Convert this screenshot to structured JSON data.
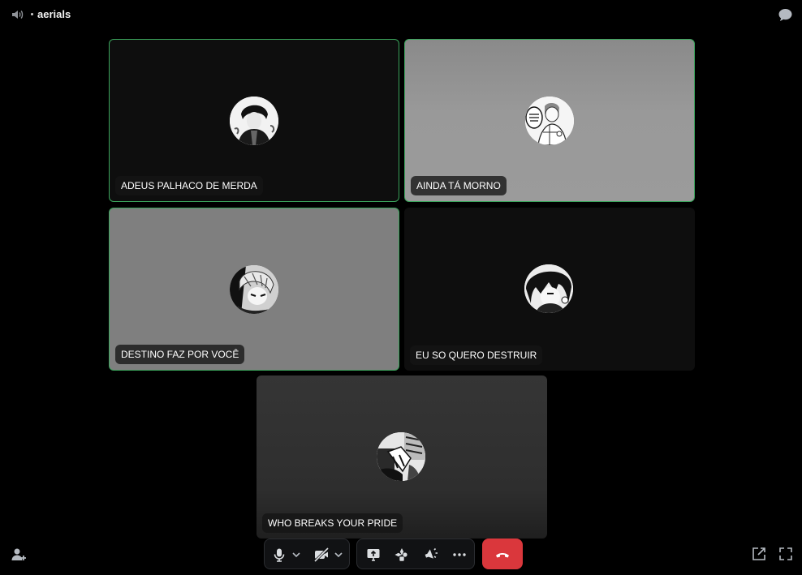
{
  "channel": {
    "name": "aerials"
  },
  "participants": [
    {
      "name": "ADEUS PALHACO DE MERDA"
    },
    {
      "name": "AINDA TÁ MORNO"
    },
    {
      "name": "DESTINO FAZ POR VOCÊ"
    },
    {
      "name": "EU SO QUERO DESTRUIR"
    },
    {
      "name": "WHO BREAKS YOUR PRIDE"
    }
  ],
  "colors": {
    "speaking_border": "#3ba55c",
    "hangup": "#da373c",
    "background": "#000000"
  },
  "icons": [
    "speaker-icon",
    "chat-icon",
    "microphone-icon",
    "camera-off-icon",
    "screen-share-icon",
    "activities-icon",
    "soundboard-icon",
    "more-icon",
    "hangup-icon",
    "invite-user-icon",
    "popout-icon",
    "fullscreen-icon"
  ]
}
